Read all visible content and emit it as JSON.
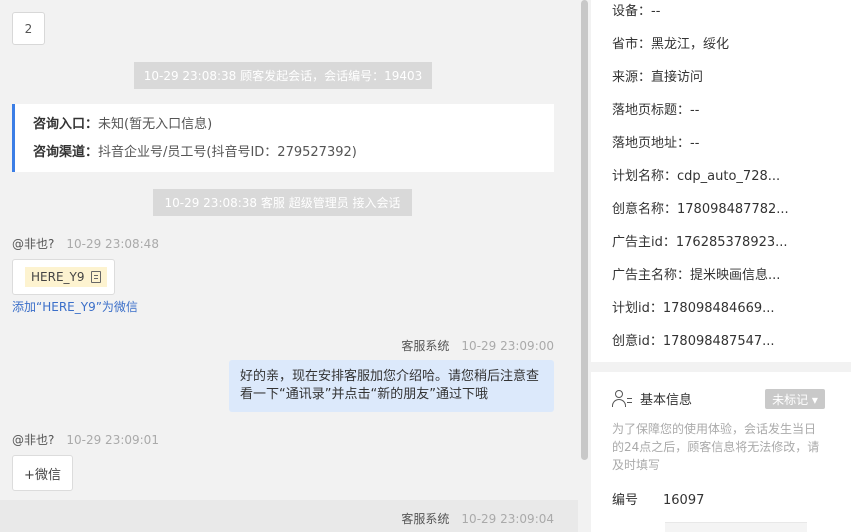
{
  "chat": {
    "count": "2",
    "session_start": "10-29 23:08:38 顾客发起会话，会话编号：19403",
    "consult_entry_label": "咨询入口：",
    "consult_entry_value": "未知(暂无入口信息)",
    "consult_channel_label": "咨询渠道：",
    "consult_channel_value": "抖音企业号/员工号(抖音号ID：279527392)",
    "agent_join": "10-29 23:08:38 客服 超级管理员 接入会话",
    "messages": [
      {
        "sender": "@非也?",
        "time": "10-29 23:08:48",
        "copy_text": "HERE_Y9",
        "link": "添加“HERE_Y9”为微信"
      },
      {
        "sender": "客服系统",
        "time": "10-29 23:09:00",
        "text": "好的亲，现在安排客服加您介绍哈。请您稍后注意查看一下“通讯录”并点击“新的朋友”通过下哦"
      },
      {
        "sender": "@非也?",
        "time": "10-29 23:09:01",
        "button": "+微信"
      },
      {
        "sender": "客服系统",
        "time": "10-29 23:09:04"
      }
    ]
  },
  "panel": {
    "fields": [
      {
        "label": "设备：",
        "value": "--"
      },
      {
        "label": "省市：",
        "value": "黑龙江，绥化"
      },
      {
        "label": "来源：",
        "value": "直接访问"
      },
      {
        "label": "落地页标题：",
        "value": "--"
      },
      {
        "label": "落地页地址：",
        "value": "--"
      },
      {
        "label": "计划名称：",
        "value": "cdp_auto_728..."
      },
      {
        "label": "创意名称：",
        "value": "178098487782..."
      },
      {
        "label": "广告主id：",
        "value": "176285378923..."
      },
      {
        "label": "广告主名称：",
        "value": "提米映画信息..."
      },
      {
        "label": "计划id：",
        "value": "178098484669..."
      },
      {
        "label": "创意id：",
        "value": "178098487547..."
      }
    ],
    "basic_info_title": "基本信息",
    "tag_button": "未标记 ▾",
    "hint": "为了保障您的使用体验，会话发生当日的24点之后，顾客信息将无法修改，请及时填写",
    "id_label": "编号",
    "id_value": "16097"
  }
}
